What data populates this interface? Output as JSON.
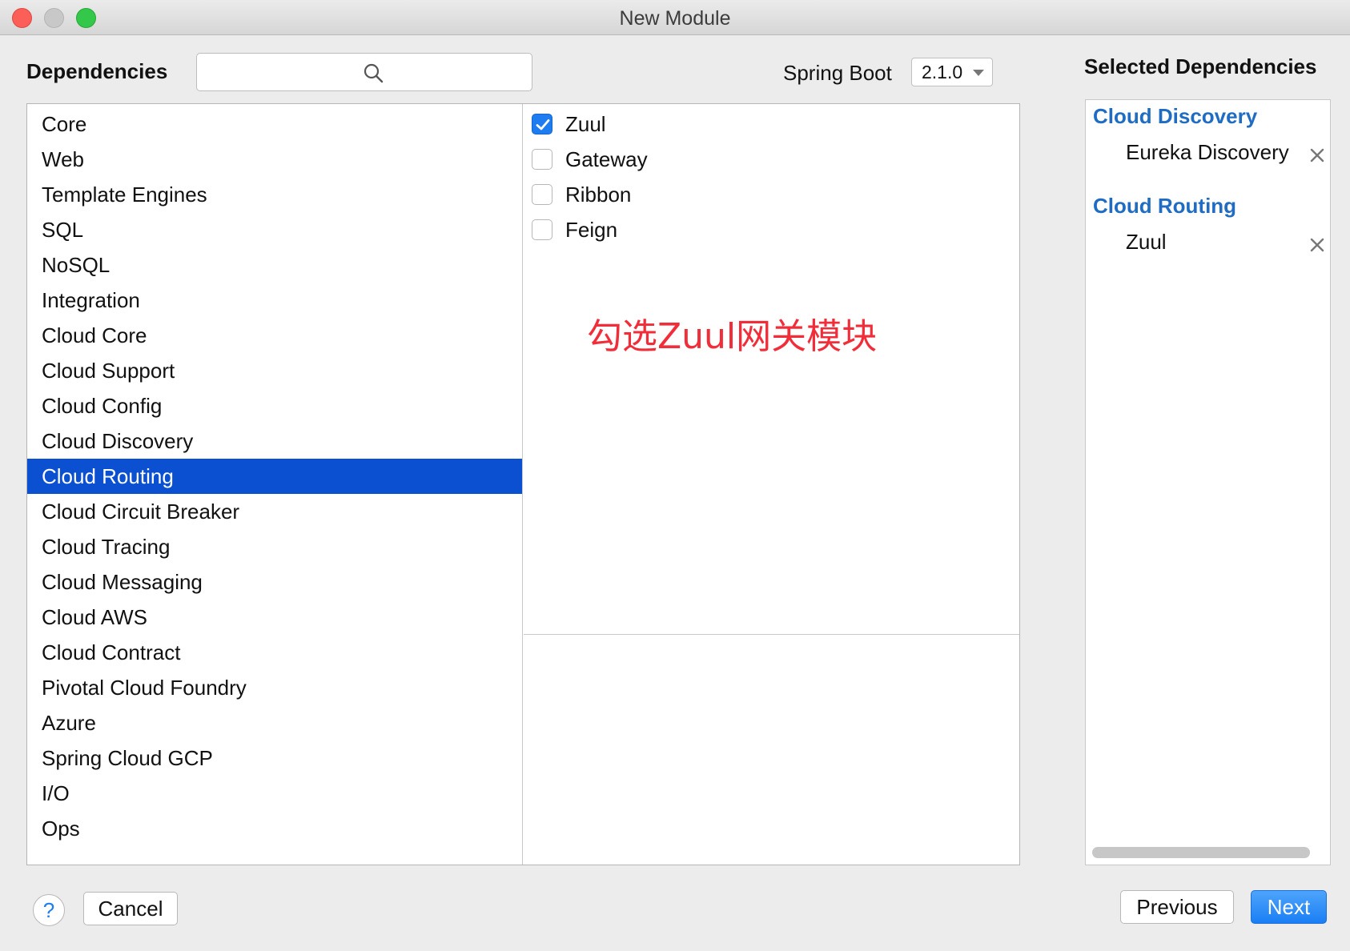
{
  "window": {
    "title": "New Module"
  },
  "header": {
    "dependencies_label": "Dependencies",
    "search_value": "",
    "spring_boot_label": "Spring Boot",
    "spring_boot_version": "2.1.0",
    "selected_label": "Selected Dependencies"
  },
  "categories": [
    "Core",
    "Web",
    "Template Engines",
    "SQL",
    "NoSQL",
    "Integration",
    "Cloud Core",
    "Cloud Support",
    "Cloud Config",
    "Cloud Discovery",
    "Cloud Routing",
    "Cloud Circuit Breaker",
    "Cloud Tracing",
    "Cloud Messaging",
    "Cloud AWS",
    "Cloud Contract",
    "Pivotal Cloud Foundry",
    "Azure",
    "Spring Cloud GCP",
    "I/O",
    "Ops"
  ],
  "selected_category": "Cloud Routing",
  "dependencies": [
    {
      "label": "Zuul",
      "checked": true
    },
    {
      "label": "Gateway",
      "checked": false
    },
    {
      "label": "Ribbon",
      "checked": false
    },
    {
      "label": "Feign",
      "checked": false
    }
  ],
  "annotation": "勾选Zuul网关模块",
  "selected_dependencies": [
    {
      "group": "Cloud Discovery",
      "items": [
        "Eureka Discovery"
      ]
    },
    {
      "group": "Cloud Routing",
      "items": [
        "Zuul"
      ]
    }
  ],
  "footer": {
    "help_label": "?",
    "cancel_label": "Cancel",
    "previous_label": "Previous",
    "next_label": "Next"
  },
  "colors": {
    "selection": "#0b50d0",
    "accent": "#1c7cf0",
    "group_heading": "#1f6cc2",
    "annotation": "#f22d3a"
  }
}
